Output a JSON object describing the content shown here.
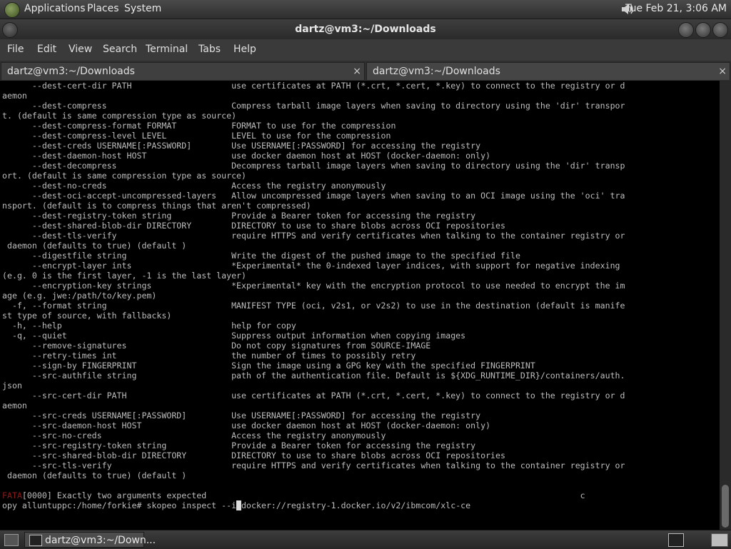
{
  "top_panel": {
    "menus": [
      "Applications",
      "Places",
      "System"
    ],
    "clock": "Tue Feb 21,  3:06 AM"
  },
  "window": {
    "title": "dartz@vm3:~/Downloads"
  },
  "menubar": {
    "items": [
      "File",
      "Edit",
      "View",
      "Search",
      "Terminal",
      "Tabs",
      "Help"
    ]
  },
  "tabs": [
    {
      "label": "dartz@vm3:~/Downloads",
      "close": "×"
    },
    {
      "label": "dartz@vm3:~/Downloads",
      "close": "×"
    }
  ],
  "terminal": {
    "lines": [
      "      --dest-cert-dir PATH                    use certificates at PATH (*.crt, *.cert, *.key) to connect to the registry or d",
      "aemon",
      "      --dest-compress                         Compress tarball image layers when saving to directory using the 'dir' transpor",
      "t. (default is same compression type as source)",
      "      --dest-compress-format FORMAT           FORMAT to use for the compression",
      "      --dest-compress-level LEVEL             LEVEL to use for the compression",
      "      --dest-creds USERNAME[:PASSWORD]        Use USERNAME[:PASSWORD] for accessing the registry",
      "      --dest-daemon-host HOST                 use docker daemon host at HOST (docker-daemon: only)",
      "      --dest-decompress                       Decompress tarball image layers when saving to directory using the 'dir' transp",
      "ort. (default is same compression type as source)",
      "      --dest-no-creds                         Access the registry anonymously",
      "      --dest-oci-accept-uncompressed-layers   Allow uncompressed image layers when saving to an OCI image using the 'oci' tra",
      "nsport. (default is to compress things that aren't compressed)",
      "      --dest-registry-token string            Provide a Bearer token for accessing the registry",
      "      --dest-shared-blob-dir DIRECTORY        DIRECTORY to use to share blobs across OCI repositories",
      "      --dest-tls-verify                       require HTTPS and verify certificates when talking to the container registry or",
      " daemon (defaults to true) (default )",
      "      --digestfile string                     Write the digest of the pushed image to the specified file",
      "      --encrypt-layer ints                    *Experimental* the 0-indexed layer indices, with support for negative indexing",
      "(e.g. 0 is the first layer, -1 is the last layer)",
      "      --encryption-key strings                *Experimental* key with the encryption protocol to use needed to encrypt the im",
      "age (e.g. jwe:/path/to/key.pem)",
      "  -f, --format string                         MANIFEST TYPE (oci, v2s1, or v2s2) to use in the destination (default is manife",
      "st type of source, with fallbacks)",
      "  -h, --help                                  help for copy",
      "  -q, --quiet                                 Suppress output information when copying images",
      "      --remove-signatures                     Do not copy signatures from SOURCE-IMAGE",
      "      --retry-times int                       the number of times to possibly retry",
      "      --sign-by FINGERPRINT                   Sign the image using a GPG key with the specified FINGERPRINT",
      "      --src-authfile string                   path of the authentication file. Default is ${XDG_RUNTIME_DIR}/containers/auth.",
      "json",
      "      --src-cert-dir PATH                     use certificates at PATH (*.crt, *.cert, *.key) to connect to the registry or d",
      "aemon",
      "      --src-creds USERNAME[:PASSWORD]         Use USERNAME[:PASSWORD] for accessing the registry",
      "      --src-daemon-host HOST                  use docker daemon host at HOST (docker-daemon: only)",
      "      --src-no-creds                          Access the registry anonymously",
      "      --src-registry-token string             Provide a Bearer token for accessing the registry",
      "      --src-shared-blob-dir DIRECTORY         DIRECTORY to use to share blobs across OCI repositories",
      "      --src-tls-verify                        require HTTPS and verify certificates when talking to the container registry or",
      " daemon (defaults to true) (default )",
      ""
    ],
    "error_prefix": "FATA",
    "error_text": "[0000] Exactly two arguments expected                                                                           c",
    "prompt_before_cursor": "opy alluntuppc:/home/forkie# skopeo inspect --i",
    "prompt_cursor_char": " ",
    "prompt_after_cursor": "docker://registry-1.docker.io/v2/ibmcom/xlc-ce"
  },
  "taskbar": {
    "task_label": "dartz@vm3:~/Down..."
  },
  "colors": {
    "terminal_text": "#bdbdbd",
    "error_red": "#8b1a1a",
    "panel_bg": "#2e2e2e"
  }
}
